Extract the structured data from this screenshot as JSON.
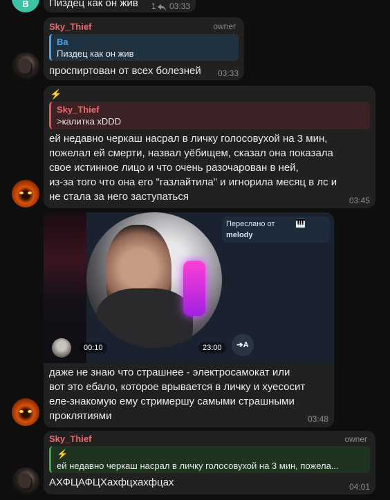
{
  "messages": [
    {
      "text": "Пиздец как он жив",
      "views": "1",
      "time": "03:33"
    },
    {
      "author": "Sky_Thief",
      "role": "owner",
      "reply_author": "Ba",
      "reply_text": "Пиздец как он жив",
      "text": "проспиртован от всех болезней",
      "time": "03:33"
    },
    {
      "reply_author": "Sky_Thief",
      "reply_text": ">калитка xDDD",
      "text": "ей недавно черкаш насрал в личку голосовухой на 3 мин,\nпожелал ей смерти, назвал уёбищем, сказал она показала\nсвое истинное лицо и что очень разочарован в ней,\n из-за того что она его \"газлайтила\" и игнорила месяц в лс и\nне стала за него заступаться",
      "time": "03:45"
    },
    {
      "forward_label": "Переслано от",
      "forward_from": "melody",
      "video_duration": "00:10",
      "video_total": "23:00",
      "translate_label": "A",
      "text": "даже не знаю что страшнее -  электросамокат или\nвот это ебало, которое врывается в личку и хуесосит\nеле-знакомую ему стримершу самыми страшными\nпроклятиями",
      "time": "03:48"
    },
    {
      "author": "Sky_Thief",
      "role": "owner",
      "reply_text": "ей недавно черкаш насрал в личку голосовухой на 3 мин, пожела...",
      "text": "АХФЦАФЦХахфцхахфцах",
      "time": "04:01"
    }
  ],
  "avatars": {
    "b_letter": "B"
  },
  "icons": {
    "bolt": "⚡",
    "reply_arrow": "reply-arrow-icon",
    "piano": "🎹"
  },
  "colors": {
    "author_name": "#e96c6c",
    "reply_blue": "#4ea3e6",
    "reply_red": "#e3575c",
    "reply_green": "#3aab42",
    "bubble": "#212121",
    "background": "#0e0e0e"
  }
}
